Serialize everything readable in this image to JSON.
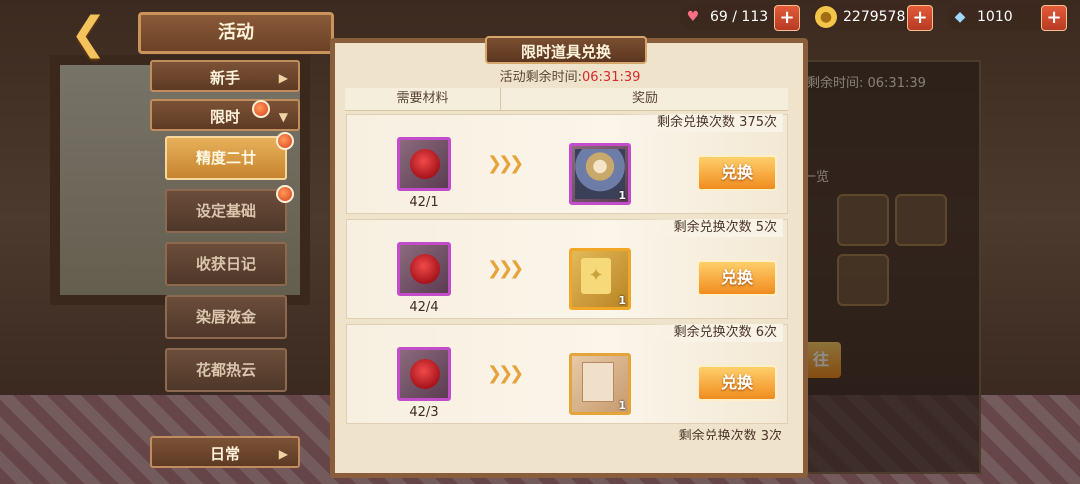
{
  "top_bar": {
    "panel_title": "活动",
    "resources": [
      {
        "icon": "heart-icon",
        "value": "69 / 113"
      },
      {
        "icon": "gold-coin-icon",
        "value": "2279578"
      },
      {
        "icon": "crystal-icon",
        "value": "1010"
      }
    ]
  },
  "menu": {
    "categories": [
      {
        "label": "新手",
        "arrow": "▶"
      },
      {
        "label": "限时",
        "arrow": "▼"
      },
      {
        "label": "日常",
        "arrow": "▶"
      }
    ],
    "sub_items": [
      {
        "label": "精度二廿",
        "active": true
      },
      {
        "label": "设定基础",
        "active": false
      },
      {
        "label": "收获日记",
        "active": false
      },
      {
        "label": "染唇液金",
        "active": false
      },
      {
        "label": "花都热云",
        "active": false
      }
    ]
  },
  "background_panel": {
    "timer": "剩余时间: 06:31:39",
    "list_label": "一览",
    "go_label": "往"
  },
  "dialog": {
    "title": "限时道具兑换",
    "time_label": "活动剩余时间:",
    "time_value": "06:31:39",
    "col_material": "需要材料",
    "col_reward": "奖励",
    "rows": [
      {
        "remaining": "剩余兑换次数 375次",
        "material_count": "42/1",
        "reward_type": "portrait",
        "reward_qty": "1",
        "button": "兑换"
      },
      {
        "remaining": "剩余兑换次数 5次",
        "material_count": "42/4",
        "reward_type": "ticket",
        "reward_qty": "1",
        "button": "兑换"
      },
      {
        "remaining": "剩余兑换次数 6次",
        "material_count": "42/3",
        "reward_type": "card",
        "reward_qty": "1",
        "button": "兑换"
      }
    ],
    "partial_row_remaining": "剩余兑换次数 3次"
  },
  "colors": {
    "accent_orange": "#f08c1f",
    "timer_red": "#d62a2a",
    "purple_frame": "#c24cc9",
    "gold_frame": "#f0a728"
  }
}
